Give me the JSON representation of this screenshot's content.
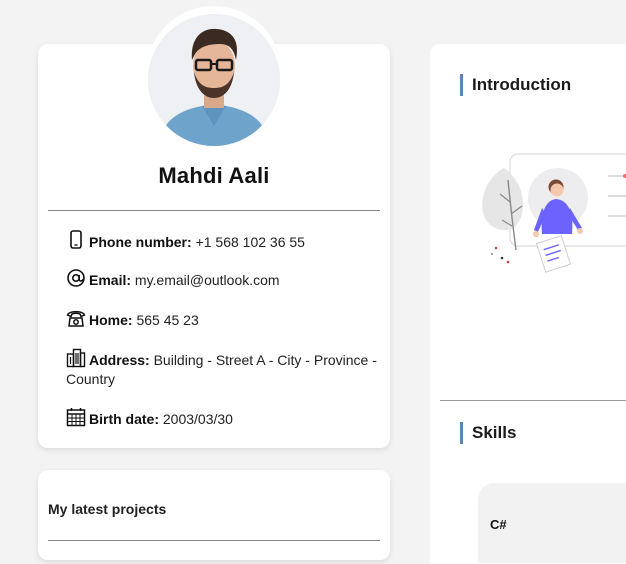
{
  "profile": {
    "name": "Mahdi Aali",
    "avatar_icon": "profile-photo",
    "contacts": [
      {
        "icon": "phone-icon",
        "label": "Phone number:",
        "value": "+1 568 102 36 55"
      },
      {
        "icon": "at-sign-icon",
        "label": "Email:",
        "value": "my.email@outlook.com"
      },
      {
        "icon": "telephone-icon",
        "label": "Home:",
        "value": "565 45 23"
      },
      {
        "icon": "building-icon",
        "label": "Address:",
        "value": "Building - Street A - City - Province - Country"
      },
      {
        "icon": "calendar-icon",
        "label": "Birth date:",
        "value": "2003/03/30"
      }
    ]
  },
  "projects": {
    "title": "My latest projects"
  },
  "main": {
    "introduction_title": "Introduction",
    "skills_title": "Skills",
    "skills": [
      {
        "name": "C#"
      }
    ],
    "accent_color": "#5b86b9",
    "illustration_accent": "#6c63ff"
  }
}
